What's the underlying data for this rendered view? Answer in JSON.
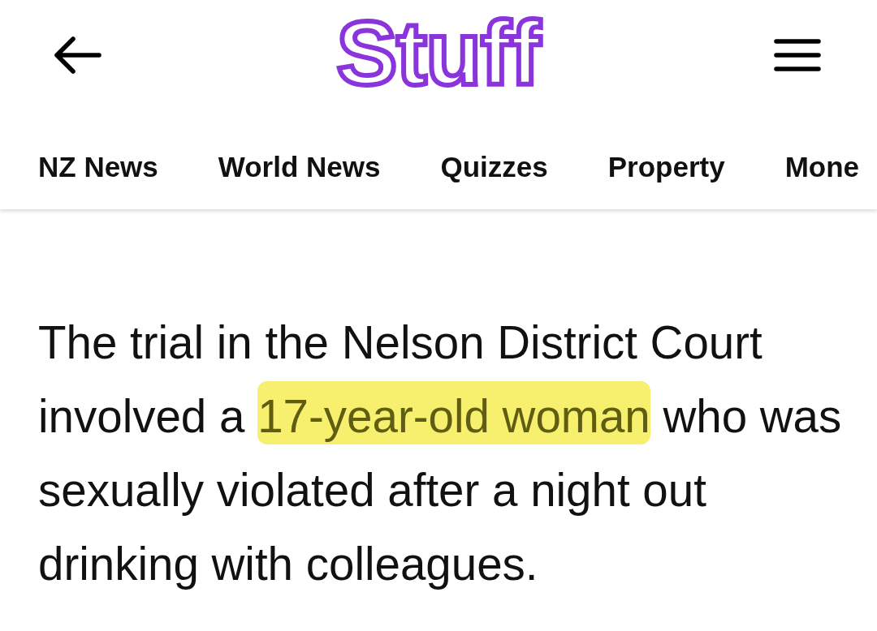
{
  "header": {
    "logo": "Stuff"
  },
  "nav": {
    "items": [
      {
        "label": "NZ News"
      },
      {
        "label": "World News"
      },
      {
        "label": "Quizzes"
      },
      {
        "label": "Property"
      },
      {
        "label": "Mone"
      }
    ]
  },
  "article": {
    "paragraph": [
      {
        "text": "The trial in the Nelson District Court involved a ",
        "highlighted": false
      },
      {
        "text": "17-year-old woman",
        "highlighted": true
      },
      {
        "text": " who was sexually violated after a night out drinking with colleagues.",
        "highlighted": false
      }
    ]
  }
}
